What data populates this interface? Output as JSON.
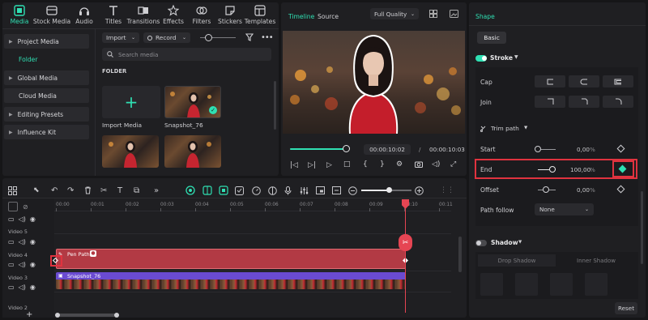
{
  "toolbar": {
    "tabs": [
      {
        "label": "Media",
        "icon": "media-icon",
        "active": true
      },
      {
        "label": "Stock Media",
        "icon": "stock-media-icon"
      },
      {
        "label": "Audio",
        "icon": "audio-icon"
      },
      {
        "label": "Titles",
        "icon": "titles-icon"
      },
      {
        "label": "Transitions",
        "icon": "transitions-icon"
      },
      {
        "label": "Effects",
        "icon": "effects-icon"
      },
      {
        "label": "Filters",
        "icon": "filters-icon"
      },
      {
        "label": "Stickers",
        "icon": "stickers-icon"
      },
      {
        "label": "Templates",
        "icon": "templates-icon"
      }
    ]
  },
  "sidebar": {
    "items": [
      {
        "label": "Project Media",
        "expandable": true
      },
      {
        "label": "Folder",
        "active": true
      },
      {
        "label": "Global Media",
        "expandable": true
      },
      {
        "label": "Cloud Media"
      },
      {
        "label": "Editing Presets",
        "expandable": true
      },
      {
        "label": "Influence Kit",
        "expandable": true
      }
    ]
  },
  "media": {
    "import_label": "Import",
    "record_label": "Record",
    "search_placeholder": "Search media",
    "folder_heading": "FOLDER",
    "items": [
      {
        "label": "Import Media"
      },
      {
        "label": "Snapshot_76"
      }
    ]
  },
  "player": {
    "tab_timeline": "Timeline",
    "tab_source": "Source",
    "quality": "Full Quality",
    "current_time": "00:00:10:02",
    "separator": "/",
    "total_time": "00:00:10:03",
    "progress": 0.98
  },
  "timeline": {
    "ruler": [
      "00:00",
      "00:01",
      "00:02",
      "00:03",
      "00:04",
      "00:05",
      "00:06",
      "00:07",
      "00:08",
      "00:09",
      "00:10",
      "00:11"
    ],
    "zoom": 0.55,
    "tracks": [
      {
        "label": "Video 5"
      },
      {
        "label": "Video 4"
      },
      {
        "label": "Video 3"
      },
      {
        "label": "Video 2"
      }
    ],
    "clips": [
      {
        "label": "Pen Path",
        "track": "Video 4",
        "color": "#b23a44"
      },
      {
        "label": "Snapshot_76",
        "track": "Video 3",
        "color": "#6a4bd1"
      }
    ],
    "add_track_label": "+"
  },
  "properties": {
    "title": "Shape",
    "tab_basic": "Basic",
    "stroke_label": "Stroke",
    "stroke_on": true,
    "cap_label": "Cap",
    "join_label": "Join",
    "trim_path_label": "Trim path",
    "start_label": "Start",
    "start_value": "0,00",
    "start_unit": "%",
    "end_label": "End",
    "end_value": "100,00",
    "end_unit": "%",
    "offset_label": "Offset",
    "offset_value": "0,00",
    "offset_unit": "%",
    "path_follow_label": "Path follow",
    "path_follow_value": "None",
    "shadow_label": "Shadow",
    "shadow_on": false,
    "drop_shadow_label": "Drop Shadow",
    "inner_shadow_label": "Inner Shadow",
    "reset_label": "Reset"
  },
  "colors": {
    "accent": "#2fe0b3",
    "highlight": "#e0333f",
    "playhead": "#e64553"
  }
}
